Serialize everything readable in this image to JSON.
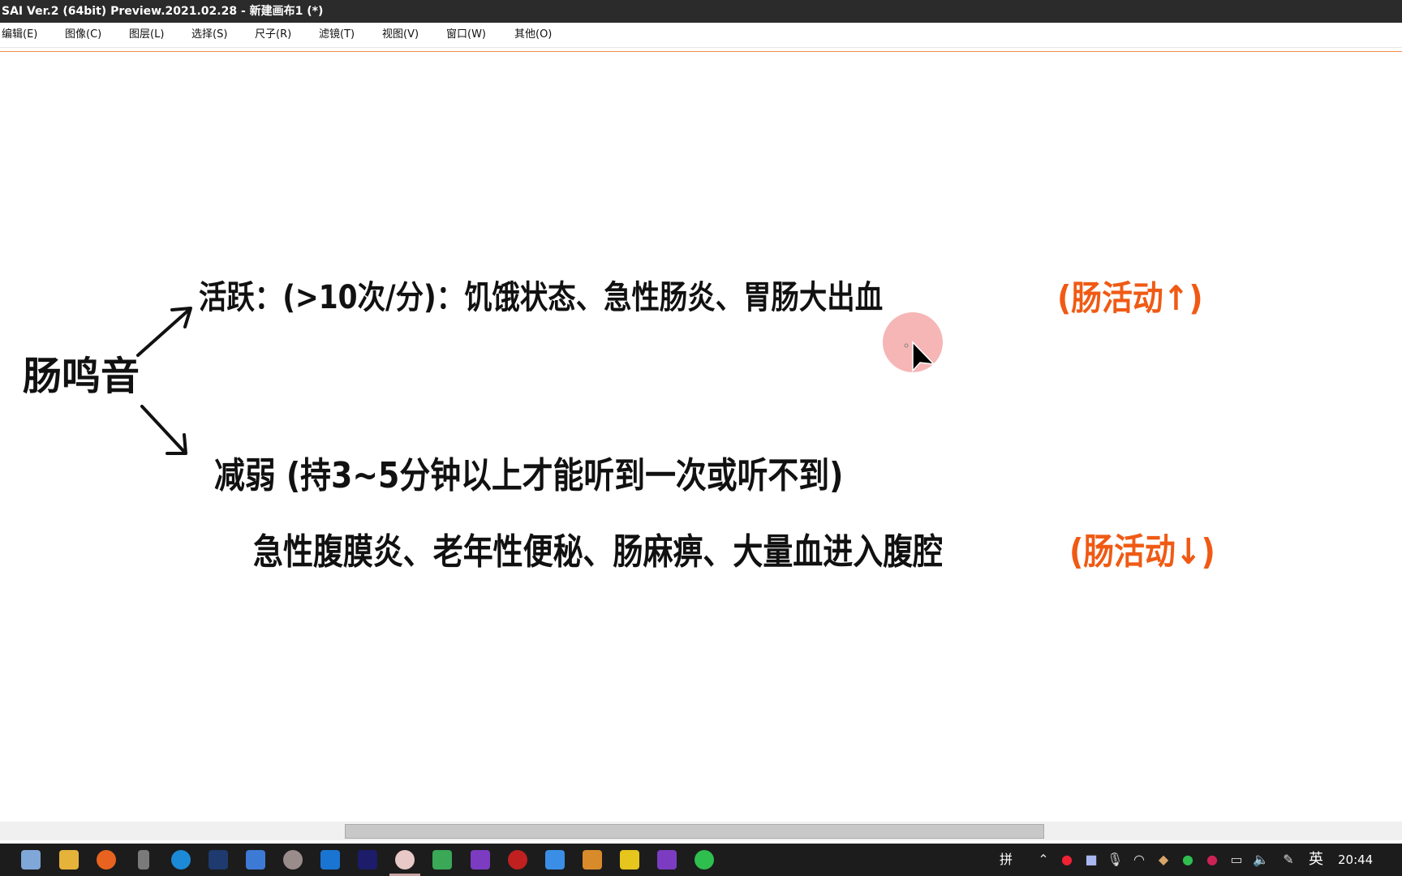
{
  "window": {
    "title": "SAI Ver.2 (64bit) Preview.2021.02.28 - 新建画布1 (*)"
  },
  "menu": [
    {
      "label": "编辑(E)"
    },
    {
      "label": "图像(C)"
    },
    {
      "label": "图层(L)"
    },
    {
      "label": "选择(S)"
    },
    {
      "label": "尺子(R)"
    },
    {
      "label": "滤镜(T)"
    },
    {
      "label": "视图(V)"
    },
    {
      "label": "窗口(W)"
    },
    {
      "label": "其他(O)"
    }
  ],
  "canvas": {
    "root": "肠鸣音",
    "upper_branch": {
      "text": "活跃：(>10次/分)：饥饿状态、急性肠炎、胃肠大出血",
      "note": "(肠活动↑)"
    },
    "lower_branch": {
      "text": "减弱 (持3~5分钟以上才能听到一次或听不到)",
      "causes": "急性腹膜炎、老年性便秘、肠麻痹、大量血进入腹腔",
      "note": "(肠活动↓)"
    },
    "colors": {
      "ink": "#111111",
      "accent": "#f05a14",
      "cursor_halo": "#f4a9a9"
    }
  },
  "taskbar": {
    "icons": [
      "notepad-icon",
      "file-explorer-icon",
      "firefox-icon",
      "usb-icon",
      "edge-icon",
      "app-icon",
      "vm-icon",
      "photos-icon",
      "todo-icon",
      "premiere-icon",
      "sai-icon",
      "app-green-icon",
      "onenote-icon",
      "record-icon",
      "app-blue-icon",
      "app-orange-icon",
      "app-yellow-icon",
      "onenote-icon-2",
      "wechat-icon"
    ],
    "tray": {
      "pinyin": "拼",
      "ime": "英",
      "time": "20:44"
    }
  }
}
